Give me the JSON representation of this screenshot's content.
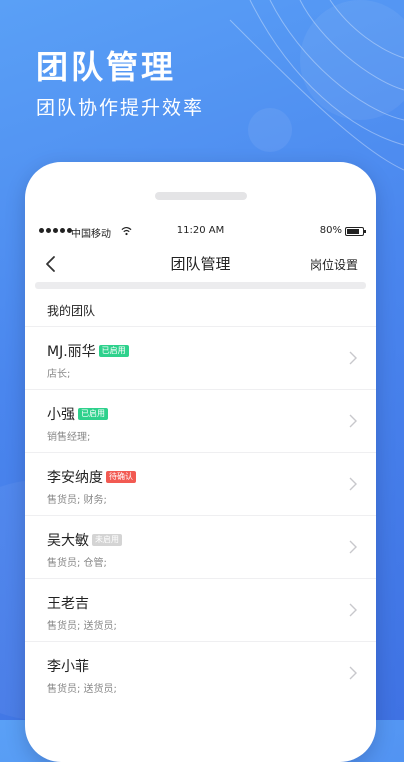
{
  "promo": {
    "title": "团队管理",
    "subtitle": "团队协作提升效率"
  },
  "status_bar": {
    "carrier": "中国移动",
    "time": "11:20 AM",
    "battery": "80%"
  },
  "nav": {
    "title": "团队管理",
    "action": "岗位设置"
  },
  "section": {
    "title": "我的团队"
  },
  "members": [
    {
      "name": "MJ.丽华",
      "badge": "已启用",
      "badge_color": "#2ed18c",
      "role": "店长;"
    },
    {
      "name": "小强",
      "badge": "已启用",
      "badge_color": "#2ed18c",
      "role": "销售经理;"
    },
    {
      "name": "李安纳度",
      "badge": "待确认",
      "badge_color": "#f25a52",
      "role": "售货员;  财务;"
    },
    {
      "name": "吴大敏",
      "badge": "未启用",
      "badge_color": "#d4d4d4",
      "role": "售货员;  仓管;"
    },
    {
      "name": "王老吉",
      "badge": "",
      "badge_color": "",
      "role": "售货员;  送货员;"
    },
    {
      "name": "李小菲",
      "badge": "",
      "badge_color": "",
      "role": "售货员;  送货员;"
    }
  ]
}
